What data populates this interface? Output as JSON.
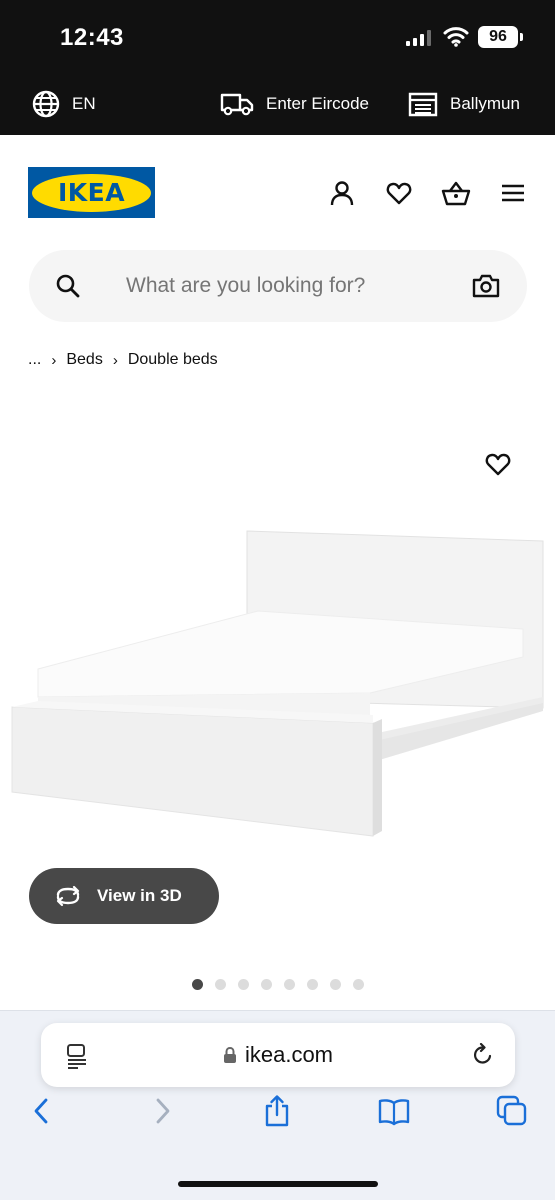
{
  "status_bar": {
    "time": "12:43",
    "battery": "96",
    "icons": [
      "cellular-signal-icon",
      "wifi-icon",
      "battery-icon"
    ]
  },
  "utility_bar": {
    "language": "EN",
    "eircode": "Enter Eircode",
    "store": "Ballymun",
    "icons": [
      "globe-icon",
      "delivery-truck-icon",
      "store-icon"
    ]
  },
  "header": {
    "logo_text": "IKEA",
    "icons": [
      "account-icon",
      "wishlist-heart-icon",
      "shopping-basket-icon",
      "menu-icon"
    ],
    "colors": {
      "logo_blue": "#0058a3",
      "logo_yellow": "#ffdb00"
    }
  },
  "search": {
    "placeholder": "What are you looking for?",
    "icons": [
      "search-icon",
      "camera-icon"
    ]
  },
  "breadcrumb": {
    "items": [
      "...",
      "Beds",
      "Double beds"
    ]
  },
  "product": {
    "view_3d_label": "View in 3D",
    "image_count": 8,
    "active_image": 1
  },
  "browser": {
    "url": "ikea.com",
    "icons": [
      "reader-icon",
      "lock-icon",
      "reload-icon",
      "back-icon",
      "forward-icon",
      "share-icon",
      "bookmarks-icon",
      "tabs-icon"
    ]
  }
}
